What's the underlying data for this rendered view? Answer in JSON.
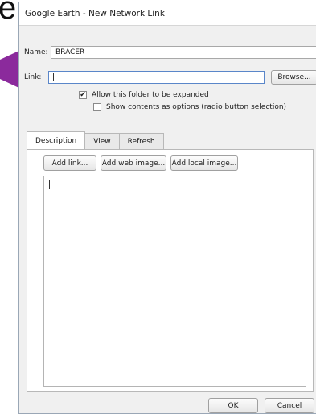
{
  "background": {
    "fragment_text": "e",
    "arrow_color": "#8b2a9c"
  },
  "dialog": {
    "title": "Google Earth - New Network Link",
    "name_label": "Name:",
    "name_value": "BRACER",
    "link_label": "Link:",
    "link_value": "",
    "browse_label": "Browse...",
    "allow_expand_label": "Allow this folder to be expanded",
    "allow_expand_checked": true,
    "show_radio_label": "Show contents as options (radio button selection)",
    "show_radio_checked": false,
    "tabs": [
      {
        "label": "Description",
        "active": true
      },
      {
        "label": "View",
        "active": false
      },
      {
        "label": "Refresh",
        "active": false
      }
    ],
    "toolbar": {
      "add_link": "Add link...",
      "add_web_image": "Add web image...",
      "add_local_image": "Add local image..."
    },
    "description_value": "",
    "ok_label": "OK",
    "cancel_label": "Cancel"
  }
}
